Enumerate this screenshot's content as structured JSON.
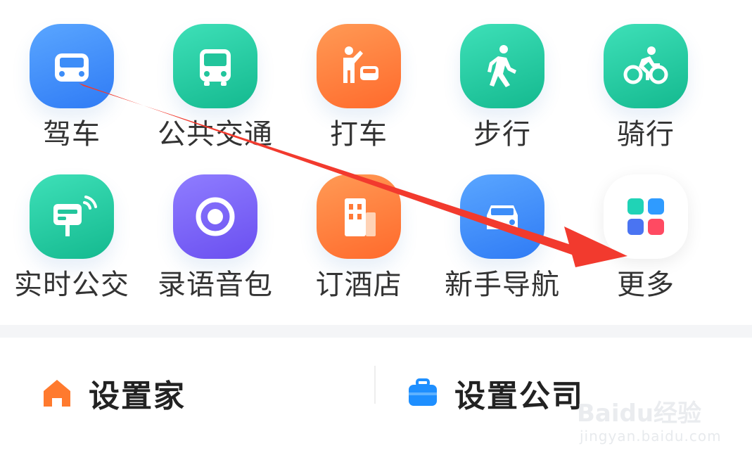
{
  "grid": {
    "row1": [
      {
        "label": "驾车",
        "icon": "car-icon"
      },
      {
        "label": "公共交通",
        "icon": "bus-icon"
      },
      {
        "label": "打车",
        "icon": "taxi-hail-icon"
      },
      {
        "label": "步行",
        "icon": "walking-icon"
      },
      {
        "label": "骑行",
        "icon": "cycling-icon"
      }
    ],
    "row2": [
      {
        "label": "实时公交",
        "icon": "bus-stop-signal-icon"
      },
      {
        "label": "录语音包",
        "icon": "record-icon"
      },
      {
        "label": "订酒店",
        "icon": "hotel-icon"
      },
      {
        "label": "新手导航",
        "icon": "car-front-icon"
      },
      {
        "label": "更多",
        "icon": "more-apps-icon"
      }
    ]
  },
  "quick": {
    "home": {
      "label": "设置家",
      "icon": "home-icon",
      "color": "#ff7a2e"
    },
    "company": {
      "label": "设置公司",
      "icon": "briefcase-icon",
      "color": "#1e8fff"
    }
  },
  "watermark": {
    "logo": "Baidu经验",
    "url": "jingyan.baidu.com"
  },
  "colors": {
    "blue": "#2f7bf5",
    "teal": "#14b98f",
    "orange": "#ff6a2c",
    "purple": "#6a4ff0",
    "arrow": "#f23a2e"
  }
}
